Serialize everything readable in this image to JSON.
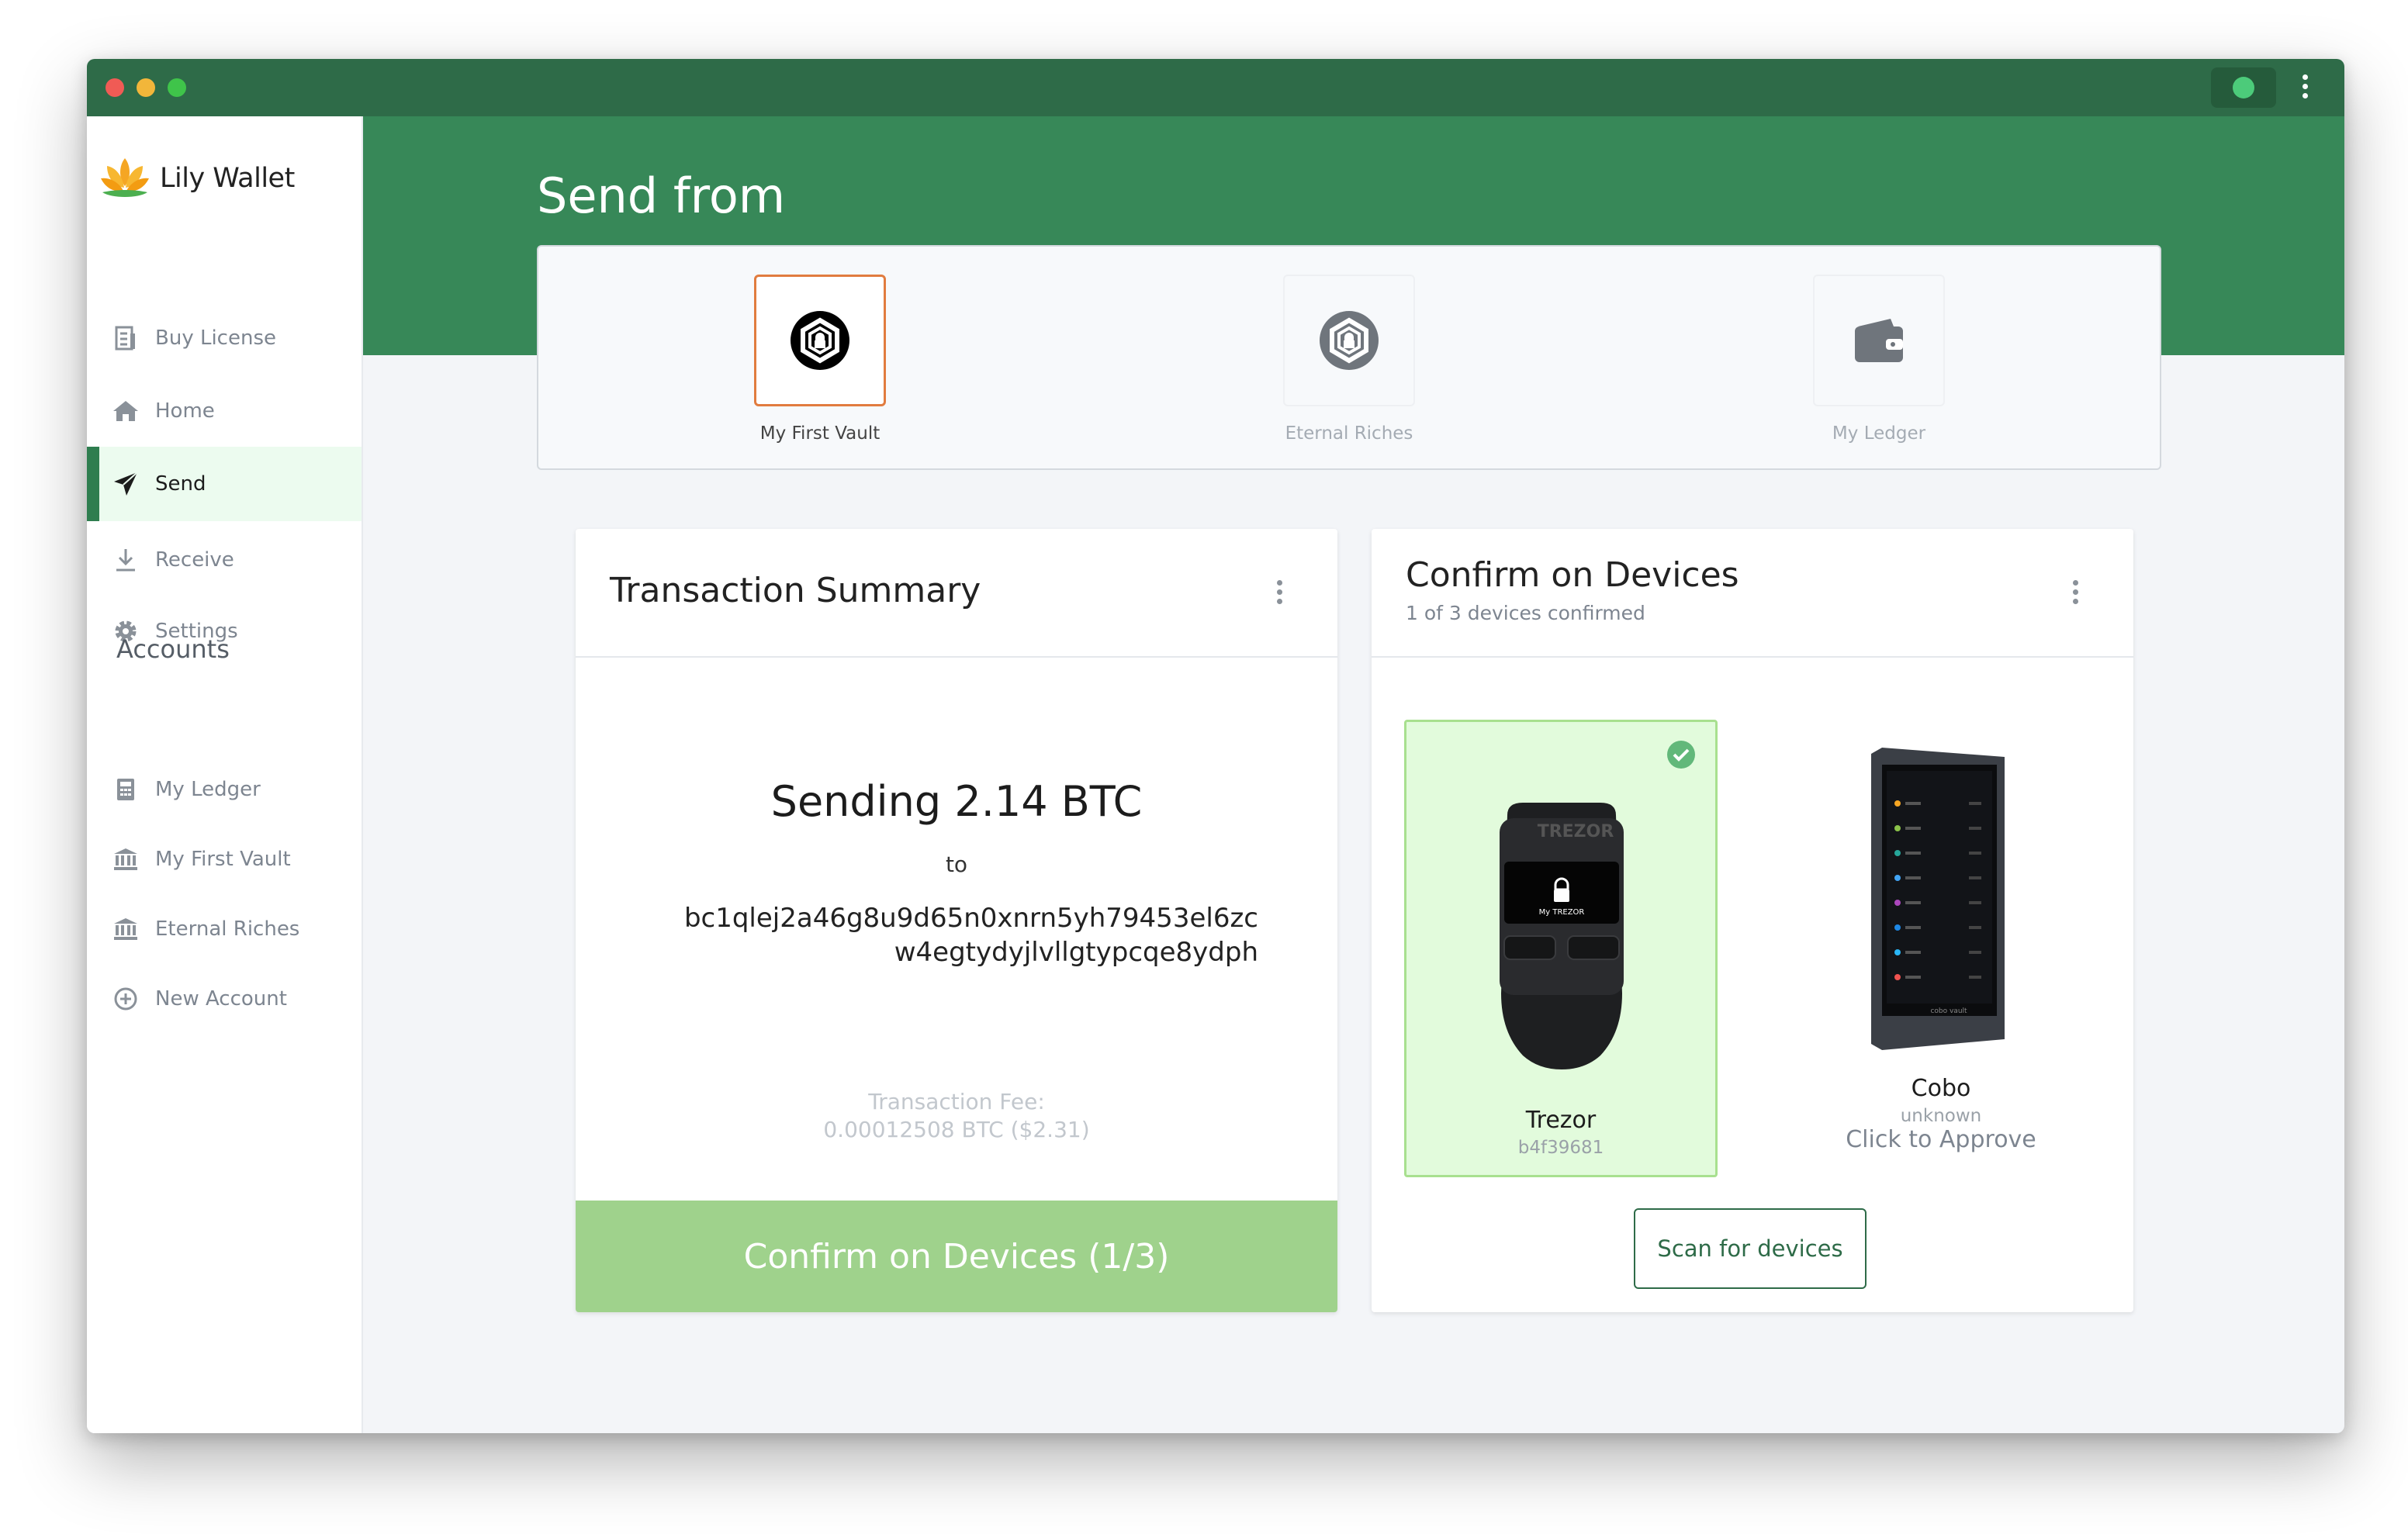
{
  "app": {
    "name": "Lily Wallet"
  },
  "sidebar": {
    "items": [
      {
        "label": "Buy License",
        "icon": "document-icon"
      },
      {
        "label": "Home",
        "icon": "home-icon"
      },
      {
        "label": "Send",
        "icon": "send-icon",
        "active": true
      },
      {
        "label": "Receive",
        "icon": "download-icon"
      },
      {
        "label": "Settings",
        "icon": "gear-icon"
      }
    ],
    "accounts_heading": "Accounts",
    "accounts": [
      {
        "label": "My Ledger",
        "icon": "calculator-icon"
      },
      {
        "label": "My First Vault",
        "icon": "bank-icon"
      },
      {
        "label": "Eternal Riches",
        "icon": "bank-icon"
      },
      {
        "label": "New Account",
        "icon": "plus-circle-icon"
      }
    ]
  },
  "header": {
    "title": "Send from"
  },
  "account_selector": [
    {
      "name": "My First Vault",
      "icon": "vault-icon",
      "selected": true
    },
    {
      "name": "Eternal Riches",
      "icon": "vault-icon",
      "selected": false
    },
    {
      "name": "My Ledger",
      "icon": "wallet-icon",
      "selected": false
    }
  ],
  "summary": {
    "title": "Transaction Summary",
    "sending": "Sending 2.14 BTC",
    "to": "to",
    "address": "bc1qlej2a46g8u9d65n0xnrn5yh79453el6zcw4egtydyjlvllgtypcqe8ydph",
    "fee_label": "Transaction Fee:",
    "fee_value": "0.00012508 BTC ($2.31)",
    "button": "Confirm on Devices (1/3)"
  },
  "devices_panel": {
    "title": "Confirm on Devices",
    "subtitle": "1 of 3 devices confirmed",
    "devices": [
      {
        "name": "Trezor",
        "fingerprint": "b4f39681",
        "confirmed": true,
        "screen_brand": "TREZOR",
        "screen_label": "My TREZOR"
      },
      {
        "name": "Cobo",
        "fingerprint": "unknown",
        "action": "Click to Approve",
        "confirmed": false,
        "brand_label": "cobo vault"
      }
    ],
    "scan_button": "Scan for devices"
  },
  "colors": {
    "titlebar": "#2e6b48",
    "hero": "#378858",
    "accent": "#2e7d4f",
    "confirm_button": "#9fd28c",
    "confirmed_device_bg": "#e2fbdc",
    "selected_border": "#e17c3f"
  }
}
